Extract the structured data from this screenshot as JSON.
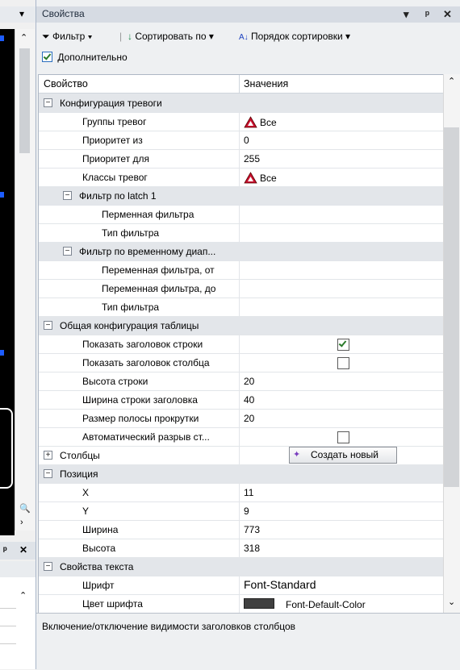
{
  "panel": {
    "title": "Свойства",
    "titlebar_buttons": [
      "▾",
      "ᵖ",
      "✕"
    ]
  },
  "toolbar": {
    "filter": "Фильтр",
    "sort_by": "Сортировать по",
    "sort_order": "Порядок сортировки",
    "advanced": "Дополнительно"
  },
  "grid": {
    "header_property": "Свойство",
    "header_values": "Значения",
    "rows": [
      {
        "name": "Конфигурация тревоги"
      },
      {
        "name": "Группы тревог",
        "value": "Все"
      },
      {
        "name": "Приоритет из",
        "value": "0"
      },
      {
        "name": "Приоритет для",
        "value": "255"
      },
      {
        "name": "Классы тревог",
        "value": "Все"
      },
      {
        "name": "Фильтр по latch 1"
      },
      {
        "name": "Перменная фильтра",
        "value": ""
      },
      {
        "name": "Тип фильтра",
        "value": ""
      },
      {
        "name": "Фильтр по временному диап..."
      },
      {
        "name": "Переменная фильтра, от",
        "value": ""
      },
      {
        "name": "Переменная фильтра, до",
        "value": ""
      },
      {
        "name": "Тип фильтра",
        "value": ""
      },
      {
        "name": "Общая конфигурация таблицы"
      },
      {
        "name": "Показать заголовок строки",
        "checked": true
      },
      {
        "name": "Показать заголовок столбца",
        "checked": false
      },
      {
        "name": "Высота строки",
        "value": "20"
      },
      {
        "name": "Ширина строки заголовка",
        "value": "40"
      },
      {
        "name": "Размер полосы прокрутки",
        "value": "20"
      },
      {
        "name": "Автоматический разрыв ст...",
        "checked": false
      },
      {
        "name": "Столбцы",
        "button": "Создать новый"
      },
      {
        "name": "Позиция"
      },
      {
        "name": "X",
        "value": "11"
      },
      {
        "name": "Y",
        "value": "9"
      },
      {
        "name": "Ширина",
        "value": "773"
      },
      {
        "name": "Высота",
        "value": "318"
      },
      {
        "name": "Свойства текста"
      },
      {
        "name": "Шрифт",
        "value": "Font-Standard"
      },
      {
        "name": "Цвет шрифта",
        "value": "Font-Default-Color"
      }
    ]
  },
  "description": "Включение/отключение видимости заголовков столбцов",
  "colors": {
    "category_bg": "#e3e6ea",
    "warn_red": "#c8102e",
    "link_blue": "#1c5cff"
  }
}
